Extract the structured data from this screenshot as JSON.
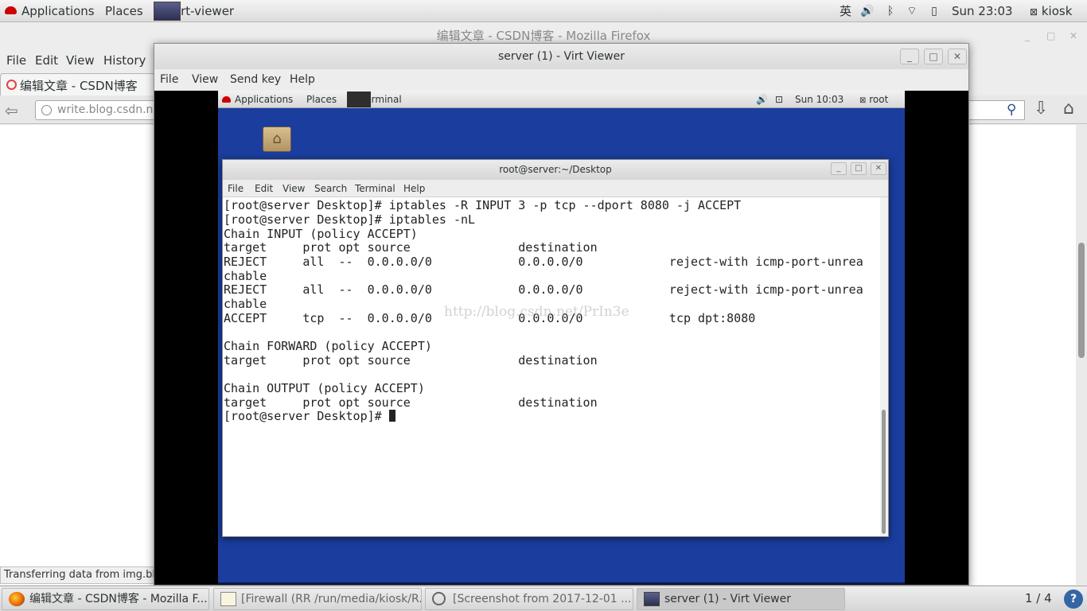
{
  "host_topbar": {
    "applications": "Applications",
    "places": "Places",
    "active_app": "Virt-viewer",
    "input_method": "英",
    "clock": "Sun 23:03",
    "user": "kiosk"
  },
  "firefox": {
    "title": "编辑文章 - CSDN博客 - Mozilla Firefox",
    "menu": [
      "File",
      "Edit",
      "View",
      "History"
    ],
    "tab_label": "编辑文章 - CSDN博客",
    "url": "write.blog.csdn.ne",
    "status": "Transferring data from img.bl"
  },
  "virt_viewer": {
    "title": "server (1) - Virt Viewer",
    "menu": [
      "File",
      "View",
      "Send key",
      "Help"
    ]
  },
  "guest": {
    "topbar": {
      "applications": "Applications",
      "places": "Places",
      "terminal": "Terminal",
      "clock": "Sun 10:03",
      "user": "root"
    },
    "terminal": {
      "title": "root@server:~/Desktop",
      "menu": [
        "File",
        "Edit",
        "View",
        "Search",
        "Terminal",
        "Help"
      ],
      "lines": [
        "[root@server Desktop]# iptables -R INPUT 3 -p tcp --dport 8080 -j ACCEPT",
        "[root@server Desktop]# iptables -nL",
        "Chain INPUT (policy ACCEPT)",
        "target     prot opt source               destination",
        "REJECT     all  --  0.0.0.0/0            0.0.0.0/0            reject-with icmp-port-unrea",
        "chable",
        "REJECT     all  --  0.0.0.0/0            0.0.0.0/0            reject-with icmp-port-unrea",
        "chable",
        "ACCEPT     tcp  --  0.0.0.0/0            0.0.0.0/0            tcp dpt:8080",
        "",
        "Chain FORWARD (policy ACCEPT)",
        "target     prot opt source               destination",
        "",
        "Chain OUTPUT (policy ACCEPT)",
        "target     prot opt source               destination",
        "[root@server Desktop]# "
      ],
      "watermark": "http://blog.csdn.net/PrIn3e"
    }
  },
  "taskbar": {
    "tasks": [
      "编辑文章 - CSDN博客 - Mozilla F...",
      "[Firewall (RR /run/media/kiosk/R...",
      "[Screenshot from 2017-12-01 ...",
      "server (1) - Virt Viewer"
    ],
    "workspace": "1 / 4",
    "help": "?"
  }
}
